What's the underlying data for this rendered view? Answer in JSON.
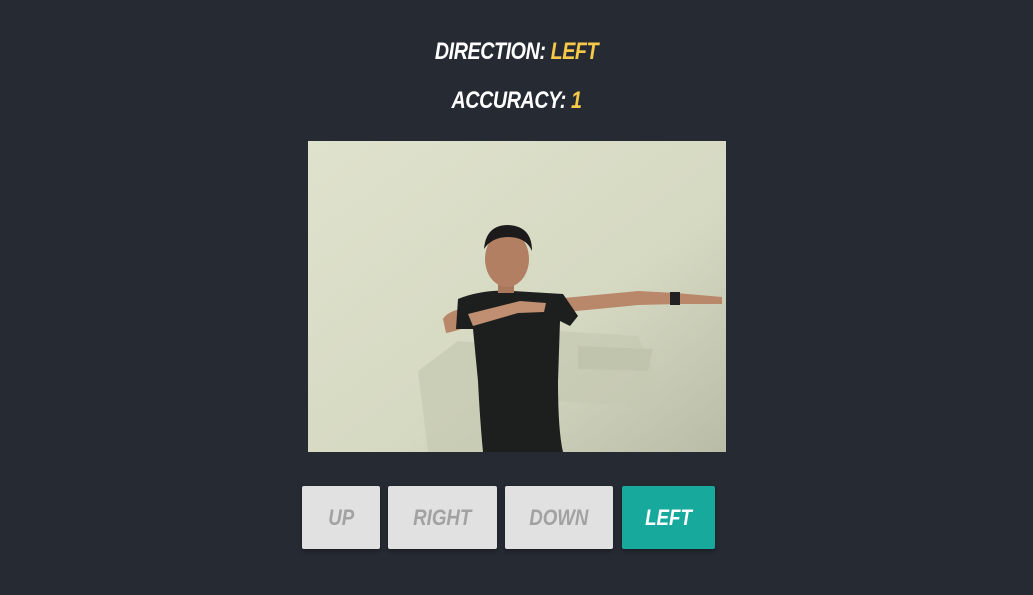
{
  "stats": {
    "direction_label": "DIRECTION:",
    "direction_value": "LEFT",
    "accuracy_label": "ACCURACY:",
    "accuracy_value": "1"
  },
  "photo": {
    "subject": "person-pointing-left"
  },
  "controls": {
    "buttons": [
      {
        "label": "UP",
        "active": false
      },
      {
        "label": "RIGHT",
        "active": false
      },
      {
        "label": "DOWN",
        "active": false
      },
      {
        "label": "LEFT",
        "active": true
      }
    ]
  },
  "colors": {
    "background": "#262a33",
    "value_accent": "#f7c948",
    "active_button": "#16a99c",
    "inactive_button": "#e1e1e1",
    "inactive_text": "#a2a2a2"
  }
}
